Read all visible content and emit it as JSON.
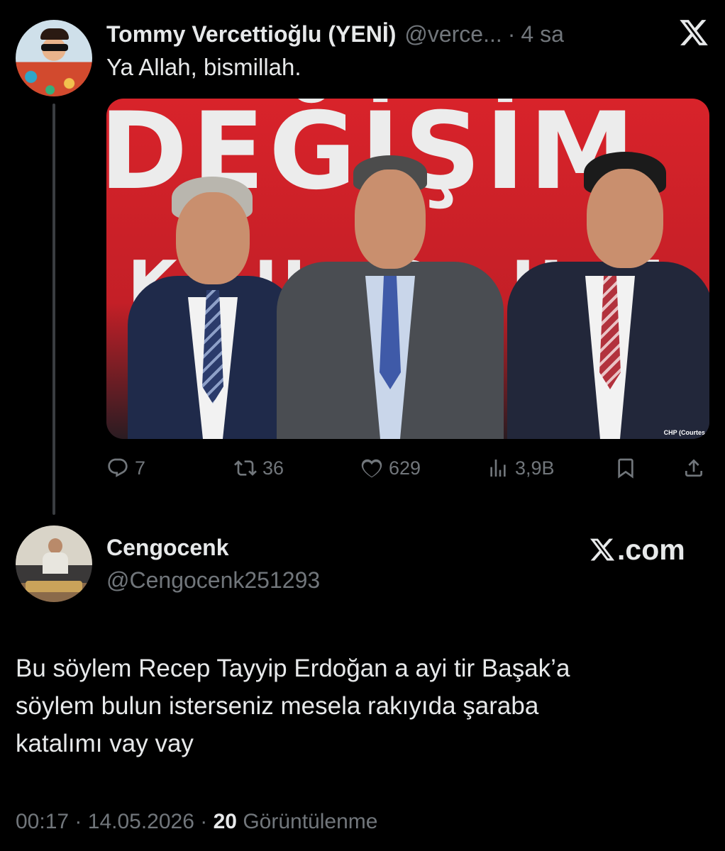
{
  "quoted": {
    "author_name": "Tommy Vercettioğlu (YENİ)",
    "handle": "@verce...",
    "separator": "·",
    "time": "4 sa",
    "text": "Ya Allah, bismillah.",
    "image": {
      "banner_top": "DEĞİŞİM",
      "banner_bottom": "KURULTAY",
      "credit": "CHP (Courtes"
    },
    "actions": {
      "replies": "7",
      "reposts": "36",
      "likes": "629",
      "views": "3,9B"
    }
  },
  "reply": {
    "author_name": "Cengocenk",
    "handle": "@Cengocenk251293",
    "site_label": ".com",
    "text_lines": [
      "Bu söylem Recep Tayyip Erdoğan a ayi tir Başak’a",
      "söylem bulun isterseniz mesela rakıyıda şaraba",
      "katalımı vay vay"
    ],
    "time": "00:17",
    "separator1": "·",
    "date": "14.05.2026",
    "separator2": "·",
    "views_count": "20",
    "views_label": "Görüntülenme"
  },
  "colors": {
    "background": "#000000",
    "primary_text": "#e7e9ea",
    "secondary_text": "#71767b",
    "thread_line": "#3a3d41",
    "banner_red": "#d8232a"
  },
  "icons": [
    "x-logo-icon",
    "reply-icon",
    "repost-icon",
    "like-icon",
    "views-icon",
    "bookmark-icon",
    "share-icon"
  ]
}
